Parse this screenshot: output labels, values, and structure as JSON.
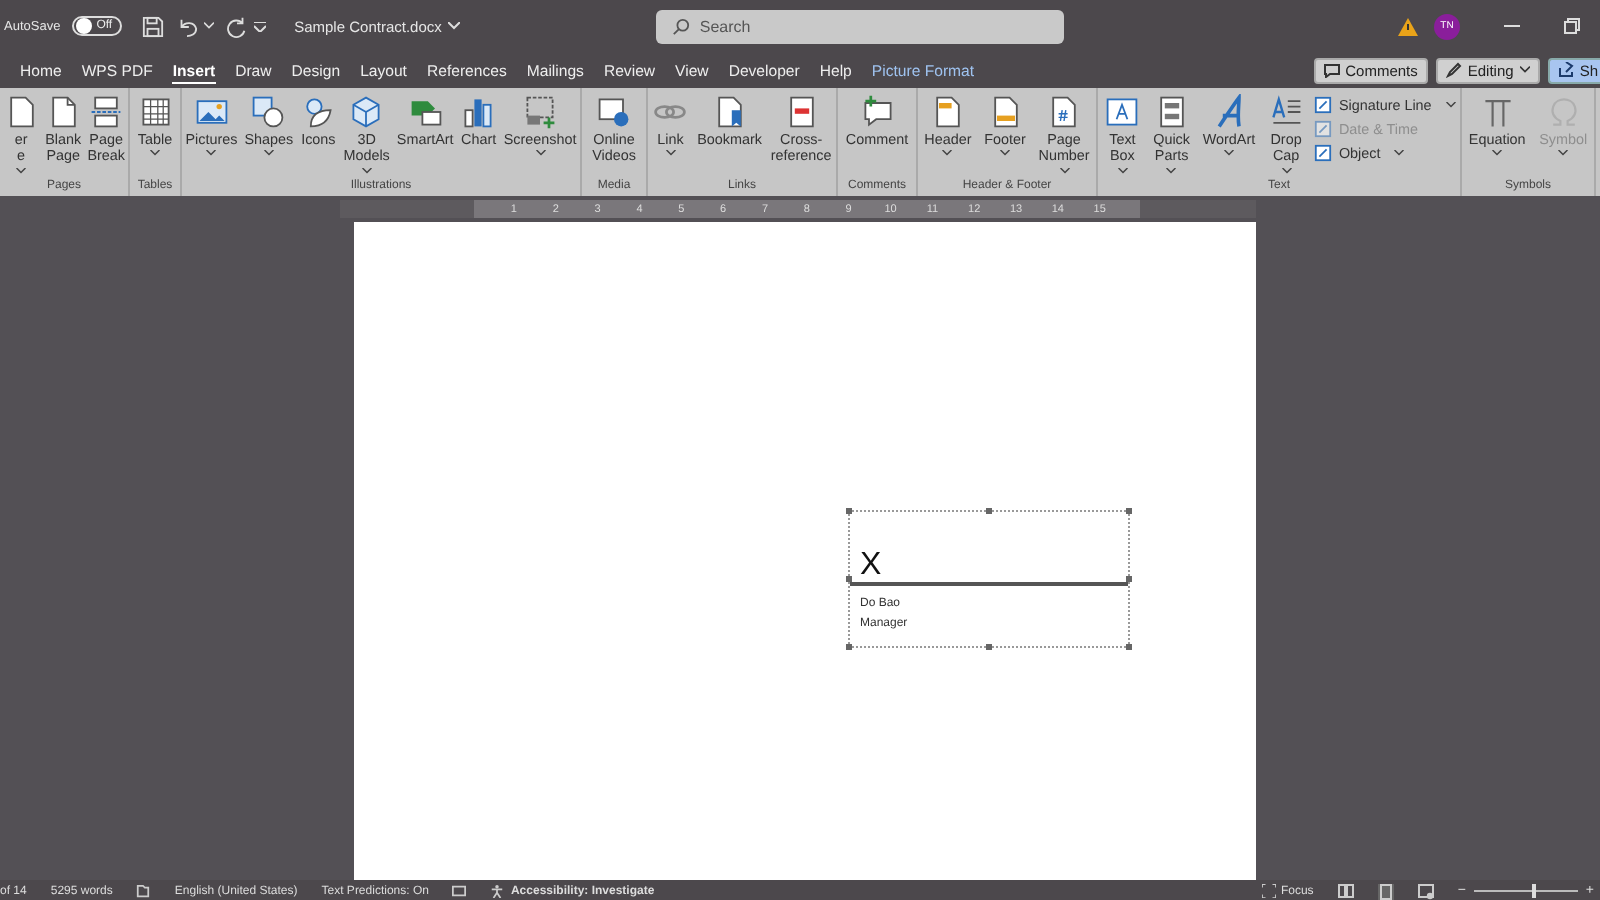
{
  "titlebar": {
    "autosave_label": "AutoSave",
    "autosave": {
      "label": "Off",
      "on": false
    },
    "filename": "Sample Contract.docx",
    "search": {
      "placeholder": "Search"
    },
    "avatar": "TN"
  },
  "tabs": [
    {
      "label": "Home",
      "selected": false,
      "kind": "normal"
    },
    {
      "label": "WPS PDF",
      "selected": false,
      "kind": "normal"
    },
    {
      "label": "Insert",
      "selected": true,
      "kind": "normal"
    },
    {
      "label": "Draw",
      "selected": false,
      "kind": "normal"
    },
    {
      "label": "Design",
      "selected": false,
      "kind": "normal"
    },
    {
      "label": "Layout",
      "selected": false,
      "kind": "normal"
    },
    {
      "label": "References",
      "selected": false,
      "kind": "normal"
    },
    {
      "label": "Mailings",
      "selected": false,
      "kind": "normal"
    },
    {
      "label": "Review",
      "selected": false,
      "kind": "normal"
    },
    {
      "label": "View",
      "selected": false,
      "kind": "normal"
    },
    {
      "label": "Developer",
      "selected": false,
      "kind": "normal"
    },
    {
      "label": "Help",
      "selected": false,
      "kind": "normal"
    },
    {
      "label": "Picture Format",
      "selected": false,
      "kind": "contextual"
    }
  ],
  "tab_actions": [
    {
      "label": "Comments",
      "kind": "comments"
    },
    {
      "label": "Editing",
      "kind": "editing"
    },
    {
      "label": "Sh",
      "kind": "share"
    }
  ],
  "ribbon": {
    "groups": [
      {
        "title": "Pages",
        "buttons": [
          {
            "label": "er e",
            "dropdown": true,
            "disabled": false
          },
          {
            "label": "Blank Page",
            "dropdown": false,
            "disabled": false
          },
          {
            "label": "Page Break",
            "dropdown": false,
            "disabled": false
          }
        ]
      },
      {
        "title": "Tables",
        "buttons": [
          {
            "label": "Table",
            "dropdown": true,
            "disabled": false
          }
        ]
      },
      {
        "title": "Illustrations",
        "buttons": [
          {
            "label": "Pictures",
            "dropdown": true,
            "disabled": false
          },
          {
            "label": "Shapes",
            "dropdown": true,
            "disabled": false
          },
          {
            "label": "Icons",
            "dropdown": false,
            "disabled": false
          },
          {
            "label": "3D Models",
            "dropdown": true,
            "disabled": false
          },
          {
            "label": "SmartArt",
            "dropdown": false,
            "disabled": false
          },
          {
            "label": "Chart",
            "dropdown": false,
            "disabled": false
          },
          {
            "label": "Screenshot",
            "dropdown": true,
            "disabled": false
          }
        ]
      },
      {
        "title": "Media",
        "buttons": [
          {
            "label": "Online Videos",
            "dropdown": false,
            "disabled": false
          }
        ]
      },
      {
        "title": "Links",
        "buttons": [
          {
            "label": "Link",
            "dropdown": true,
            "disabled": false
          },
          {
            "label": "Bookmark",
            "dropdown": false,
            "disabled": false
          },
          {
            "label": "Cross-reference",
            "dropdown": false,
            "disabled": false
          }
        ]
      },
      {
        "title": "Comments",
        "buttons": [
          {
            "label": "Comment",
            "dropdown": false,
            "disabled": false
          }
        ]
      },
      {
        "title": "Header & Footer",
        "buttons": [
          {
            "label": "Header",
            "dropdown": true,
            "disabled": false
          },
          {
            "label": "Footer",
            "dropdown": true,
            "disabled": false
          },
          {
            "label": "Page Number",
            "dropdown": true,
            "disabled": false
          }
        ]
      },
      {
        "title": "Text",
        "buttons": [
          {
            "label": "Text Box",
            "dropdown": true,
            "disabled": false
          },
          {
            "label": "Quick Parts",
            "dropdown": true,
            "disabled": false
          },
          {
            "label": "WordArt",
            "dropdown": true,
            "disabled": false
          },
          {
            "label": "Drop Cap",
            "dropdown": true,
            "disabled": false
          }
        ],
        "small_buttons": [
          {
            "label": "Signature Line",
            "dropdown": true,
            "disabled": false
          },
          {
            "label": "Date & Time",
            "dropdown": false,
            "disabled": true
          },
          {
            "label": "Object",
            "dropdown": true,
            "disabled": false
          }
        ]
      },
      {
        "title": "Symbols",
        "buttons": [
          {
            "label": "Equation",
            "dropdown": true,
            "disabled": false
          },
          {
            "label": "Symbol",
            "dropdown": true,
            "disabled": true
          }
        ]
      }
    ]
  },
  "ruler": {
    "labels": [
      "1",
      "2",
      "3",
      "4",
      "5",
      "6",
      "7",
      "8",
      "9",
      "10",
      "11",
      "12",
      "13",
      "14",
      "15"
    ]
  },
  "signature": {
    "mark": "X",
    "name": "Do Bao",
    "role": "Manager",
    "selected": true
  },
  "status_bar": {
    "page": "of 14",
    "words": "5295 words",
    "language": "English (United States)",
    "predictions": "Text Predictions: On",
    "accessibility": "Accessibility: Investigate",
    "focus": "Focus",
    "zoom_out": "−",
    "zoom_in": "+",
    "zoom": {
      "level": 0.55
    }
  }
}
